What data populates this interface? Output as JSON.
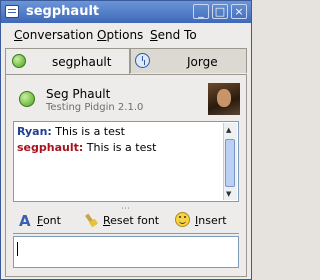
{
  "window": {
    "title": "segphault"
  },
  "titlebar_buttons": {
    "minimize": "_",
    "maximize": "□",
    "close": "×"
  },
  "menu": [
    {
      "label": "Conversation",
      "underline": "C",
      "rest": "onversation"
    },
    {
      "label": "Options",
      "underline": "O",
      "rest": "ptions"
    },
    {
      "label": "Send To",
      "underline": "S",
      "rest": "end To"
    }
  ],
  "tabs": [
    {
      "label": "segphault",
      "status_icon": "available-icon",
      "active": true
    },
    {
      "label": "Jorge",
      "status_icon": "away-clock-icon",
      "active": false
    }
  ],
  "buddy": {
    "name": "Seg Phault",
    "status": "Testing Pidgin 2.1.0"
  },
  "conversation": [
    {
      "sender": "Ryan:",
      "message": " This is a test",
      "color": "#1f3f8f"
    },
    {
      "sender": "segphault:",
      "message": " This is a test",
      "color": "#a8141e"
    }
  ],
  "format_toolbar": {
    "font": {
      "underline": "F",
      "rest": "ont"
    },
    "reset_font": {
      "underline": "R",
      "rest": "eset font"
    },
    "insert": {
      "underline": "I",
      "rest": "nsert"
    }
  },
  "input": {
    "value": ""
  }
}
